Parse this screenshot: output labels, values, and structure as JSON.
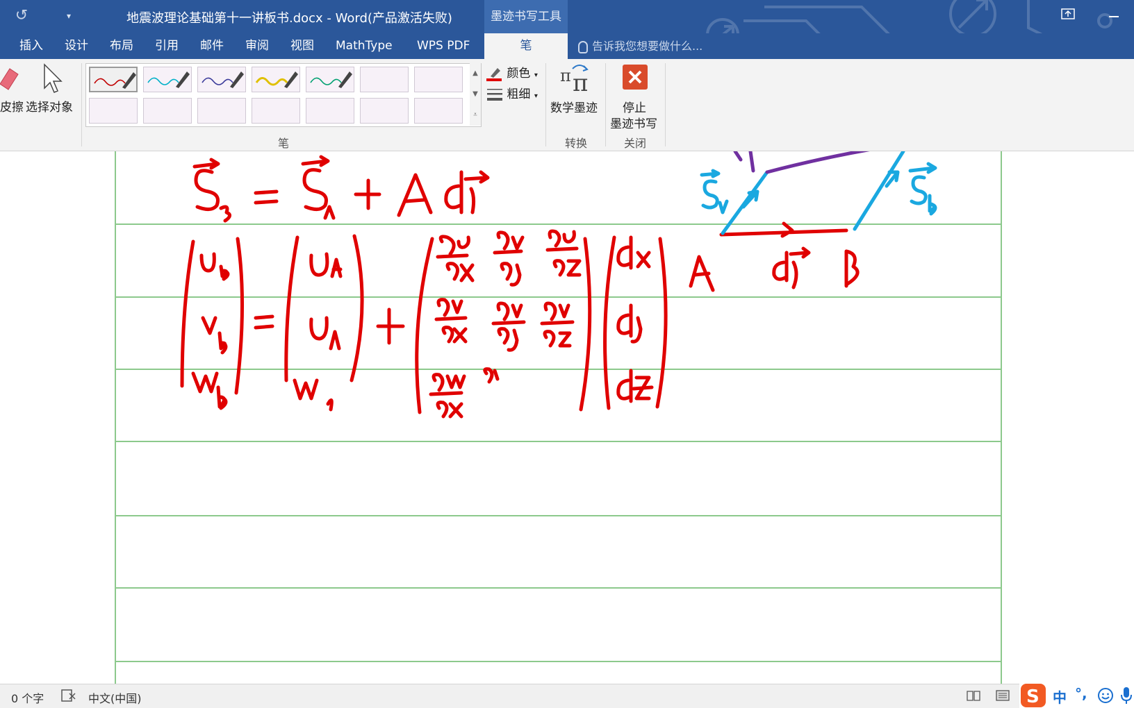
{
  "titlebar": {
    "document_title": "地震波理论基础第十一讲板书.docx - Word(产品激活失败)",
    "context_tab_title": "墨迹书写工具",
    "undo_icon": "undo-icon",
    "quick_access_dropdown": "▾",
    "restore_icon": "ribbon-display-icon",
    "minimize_icon": "minimize-icon"
  },
  "tabs": [
    {
      "label": "插入"
    },
    {
      "label": "设计"
    },
    {
      "label": "布局"
    },
    {
      "label": "引用"
    },
    {
      "label": "邮件"
    },
    {
      "label": "审阅"
    },
    {
      "label": "视图"
    },
    {
      "label": "MathType"
    },
    {
      "label": "WPS PDF"
    },
    {
      "label": "笔"
    }
  ],
  "tell_me": {
    "placeholder": "告诉我您想要做什么..."
  },
  "ribbon": {
    "eraser_label": "皮擦",
    "select_objects_label": "选择对象",
    "pens_group_label": "笔",
    "color_label": "颜色",
    "thickness_label": "粗细",
    "math_ink_label": "数学墨迹",
    "convert_group_label": "转换",
    "stop_ink_label_1": "停止",
    "stop_ink_label_2": "墨迹书写",
    "close_group_label": "关闭",
    "pens": [
      {
        "color": "#c00000"
      },
      {
        "color": "#00b0c8"
      },
      {
        "color": "#3a3a9a"
      },
      {
        "color": "#e0c000"
      },
      {
        "color": "#00a070"
      }
    ]
  },
  "ink_colors": {
    "red": "#e00000",
    "blue": "#1aa8e0",
    "purple": "#7030a0"
  },
  "statusbar": {
    "word_count": "0 个字",
    "language": "中文(中国)",
    "proofing_icon": "proofing-icon",
    "read_mode_icon": "read-mode-icon",
    "print_layout_icon": "print-layout-icon"
  },
  "ime": {
    "logo_icon": "sogou-icon",
    "mode": "中",
    "punct": "°,",
    "emoji_icon": "emoji-icon",
    "mic_icon": "mic-icon"
  }
}
